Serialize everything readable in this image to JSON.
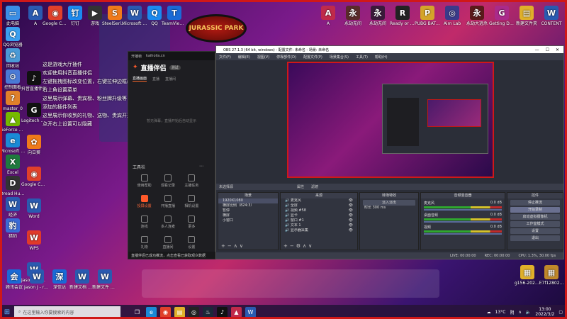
{
  "desktop": {
    "left_icons": [
      {
        "label": "此电脑",
        "glyph": "▭",
        "color": "#3a8ee6"
      },
      {
        "label": "QQ浏览器",
        "glyph": "Q",
        "color": "#3aa0f0"
      },
      {
        "label": "回收站",
        "glyph": "♻",
        "color": "#4a9ad6"
      },
      {
        "label": "控制面板",
        "glyph": "⚙",
        "color": "#4a7ad6"
      },
      {
        "label": "master_0",
        "glyph": "?",
        "color": "#e0802a"
      },
      {
        "label": "GeForce Experience",
        "glyph": "▲",
        "color": "#76b900"
      },
      {
        "label": "Microsoft Edge",
        "glyph": "e",
        "color": "#1a8ad6"
      },
      {
        "label": "Excel",
        "glyph": "X",
        "color": "#1e7a3e"
      },
      {
        "label": "Dread Hunger",
        "glyph": "D",
        "color": "#333"
      },
      {
        "label": "经济",
        "glyph": "W",
        "color": "#2a5ab0"
      },
      {
        "label": "猎豹",
        "glyph": "豹",
        "color": "#3a6ad6"
      }
    ],
    "column2_icons": [
      {
        "label": "抖音直播伴侣",
        "glyph": "♪",
        "color": "#111"
      },
      {
        "label": "Logitech G HUB",
        "glyph": "G",
        "color": "#111"
      },
      {
        "label": "向日葵",
        "glyph": "✿",
        "color": "#f07a1a"
      },
      {
        "label": "Google Chrome",
        "glyph": "◉",
        "color": "#e0402a"
      },
      {
        "label": "Word",
        "glyph": "W",
        "color": "#2a5ab0"
      },
      {
        "label": "WPS",
        "glyph": "W",
        "color": "#e03a2a"
      },
      {
        "label": "Jason J - revised...",
        "glyph": "W",
        "color": "#2a5ab0"
      }
    ],
    "top_icons": [
      {
        "label": "A",
        "glyph": "A",
        "color": "#2a5ab0"
      },
      {
        "label": "Google Chrome",
        "glyph": "◉",
        "color": "#e0402a"
      },
      {
        "label": "钉钉",
        "glyph": "钉",
        "color": "#1a8af0"
      },
      {
        "label": "游戏",
        "glyph": "▶",
        "color": "#333"
      },
      {
        "label": "SteelSeries Engine",
        "glyph": "S",
        "color": "#f07a1a"
      },
      {
        "label": "Microsoft Store",
        "glyph": "W",
        "color": "#2a5ab0"
      },
      {
        "label": "QQ",
        "glyph": "Q",
        "color": "#1a8af0"
      },
      {
        "label": "TeamViewer",
        "glyph": "T",
        "color": "#1a6ad6"
      }
    ],
    "right_icons": [
      {
        "label": "A",
        "glyph": "A",
        "color": "#c02a4a"
      },
      {
        "label": "永劫无间",
        "glyph": "永",
        "color": "#5a2a2a"
      },
      {
        "label": "永劫无间",
        "glyph": "永",
        "color": "#3a1a3a"
      },
      {
        "label": "Ready or Not",
        "glyph": "R",
        "color": "#222"
      },
      {
        "label": "PUBG BATTLEGR...",
        "glyph": "P",
        "color": "#d4a42a"
      },
      {
        "label": "Aim Lab",
        "glyph": "◎",
        "color": "#3a3a8a"
      },
      {
        "label": "永劫大逃杀",
        "glyph": "永",
        "color": "#5a1a1a"
      },
      {
        "label": "Getting Dance of F...",
        "glyph": "G",
        "color": "#aa2a8a"
      },
      {
        "label": "新建文件夹",
        "glyph": "▤",
        "color": "#e0b02a"
      },
      {
        "label": "CONTENT",
        "glyph": "W",
        "color": "#2a5ab0"
      }
    ],
    "bottom_icons": [
      {
        "label": "腾讯会议",
        "glyph": "会",
        "color": "#1a6ad6"
      },
      {
        "label": "Jason J - revised...",
        "glyph": "W",
        "color": "#2a5ab0"
      },
      {
        "label": "深信达",
        "glyph": "深",
        "color": "#1a6ad6"
      },
      {
        "label": "新建文档 WeGame",
        "glyph": "W",
        "color": "#2a5ab0"
      },
      {
        "label": "新建文件 Microsoft",
        "glyph": "W",
        "color": "#2a5ab0"
      }
    ],
    "right_bottom_icons": [
      {
        "label": "g156-2022...",
        "glyph": "▦",
        "color": "#e0b02a"
      },
      {
        "label": "E7f12802...",
        "glyph": "▦",
        "color": "#c0882a"
      }
    ],
    "jp_logo": "JURASSIC PARK",
    "tips": [
      "这是游戏大厅插件",
      "欢迎使用抖音直播伴侣",
      "左键拖拽图标改变位置，右键拉伸边框改变大小",
      "右上角设置菜单",
      "这里展示弹幕、贵宾榜、粉丝牌升级等",
      "添加的插件列表",
      "这里展示你收到的礼物、送物、贵宾开通",
      "点开右上设置可以隐藏"
    ]
  },
  "zhibo": {
    "topbar": [
      "开播帧",
      "kaihoila.cn"
    ],
    "logo": "直播伴侣",
    "badge": "测试",
    "tabs": [
      "直播画面",
      "直播",
      "直播间"
    ],
    "message": "暂无弹幕，直播开始后自动显示",
    "tools_title": "工具栏",
    "tools": [
      "使用帮助",
      "观看记录",
      "主播任务",
      "投屏设置",
      "开播直播",
      "相机设置",
      "连线",
      "多人连麦",
      "更多",
      "礼物",
      "直播间",
      "设置"
    ],
    "footer": "直播伴侣已成功推流，点击查看已获取观众数据"
  },
  "obs": {
    "title": "OBS 27.1.3 (64 bit, windows) - 配置文件: 未命名 - 场景: 未命名",
    "menu": [
      "文件(F)",
      "编辑(E)",
      "视图(V)",
      "停靠部件(D)",
      "配置文件(P)",
      "场景集合(S)",
      "工具(T)",
      "帮助(H)"
    ],
    "toolbar_left": "未选择源",
    "toolbar_right": [
      "属性",
      "滤镜"
    ],
    "scenes_title": "场景",
    "scenes": [
      "1920X1080",
      "横屏比例（824:3）",
      "暂停",
      "横屏",
      "小窗口"
    ],
    "sources_title": "来源",
    "sources": [
      "麦克风",
      "全屏",
      "视频 #58",
      "显卡",
      "窗口 #1",
      "文本 1",
      "显示器采集"
    ],
    "transitions_title": "转场特效",
    "transition": "淡入淡出",
    "duration_label": "时长",
    "duration": "300 ms",
    "mixer_title": "音频混音器",
    "mixer": [
      {
        "name": "麦克风",
        "db": "0.0 dB"
      },
      {
        "name": "桌面音频",
        "db": "0.0 dB"
      },
      {
        "name": "视频",
        "db": "0.0 dB"
      }
    ],
    "controls_title": "控件",
    "controls": [
      "停止推流",
      "开始录制",
      "启动虚拟摄像机",
      "工作室模式",
      "设置",
      "退出"
    ],
    "status": [
      "LIVE: 00:00:00",
      "REC: 00:00:00",
      "CPU: 1.3%, 30.00 fps"
    ]
  },
  "taskbar": {
    "search_placeholder": "在这里输入你要搜索的内容",
    "weather": "13°C",
    "tray_text": "阴",
    "time": "13:00",
    "date": "2022/3/2"
  }
}
